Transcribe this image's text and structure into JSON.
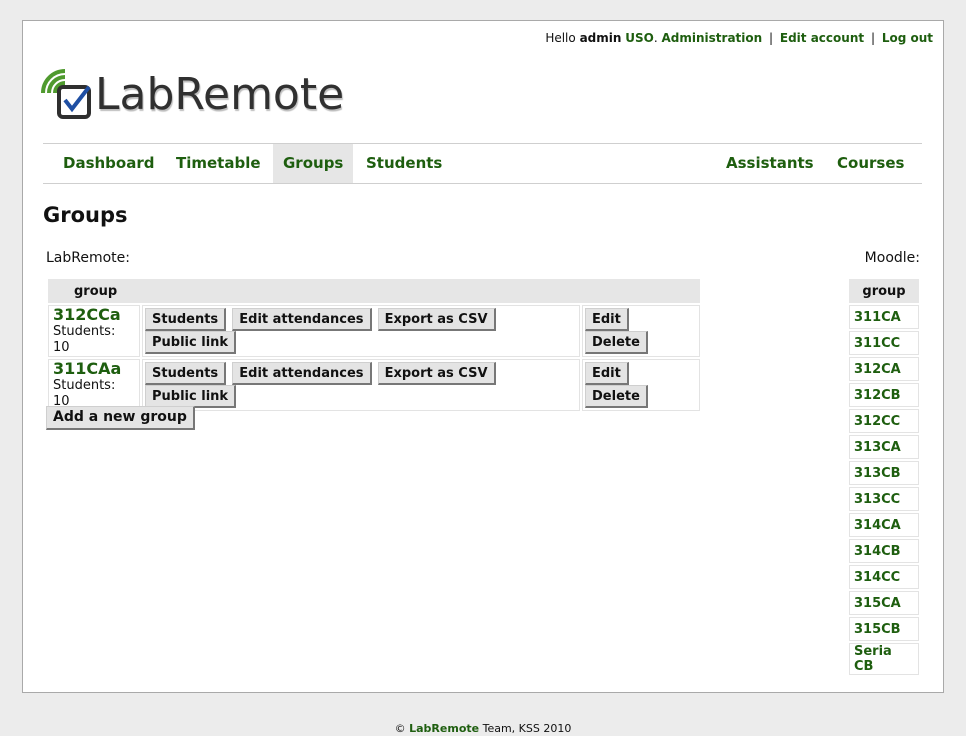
{
  "userbar": {
    "hello": "Hello",
    "username": "admin",
    "role": "USO",
    "administration": "Administration",
    "edit_account": "Edit account",
    "log_out": "Log out",
    "separator": "|"
  },
  "logo": {
    "text": "LabRemote",
    "accent": "#4f9a2e"
  },
  "nav": {
    "left": [
      "Dashboard",
      "Timetable",
      "Groups",
      "Students"
    ],
    "right": [
      "Assistants",
      "Courses"
    ],
    "active": "Groups"
  },
  "page_title": "Groups",
  "labremote_label": "LabRemote:",
  "moodle_label": "Moodle:",
  "groups_table": {
    "header": "group",
    "rows": [
      {
        "name": "312CCa",
        "students": "Students: 10"
      },
      {
        "name": "311CAa",
        "students": "Students: 10"
      }
    ],
    "actions": [
      "Students",
      "Edit attendances",
      "Export as CSV",
      "Public link"
    ],
    "manage": [
      "Edit",
      "Delete"
    ]
  },
  "add_group_label": "Add a new group",
  "moodle_table": {
    "header": "group",
    "items": [
      "311CA",
      "311CC",
      "312CA",
      "312CB",
      "312CC",
      "313CA",
      "313CB",
      "313CC",
      "314CA",
      "314CB",
      "314CC",
      "315CA",
      "315CB",
      "Seria CB"
    ]
  },
  "footer": {
    "copyright": "©",
    "brand": "LabRemote",
    "rest": "Team, KSS 2010"
  },
  "colors": {
    "link": "#1e5e0f",
    "nav_active_bg": "#e6e6e6",
    "page_bg": "#ececec"
  }
}
